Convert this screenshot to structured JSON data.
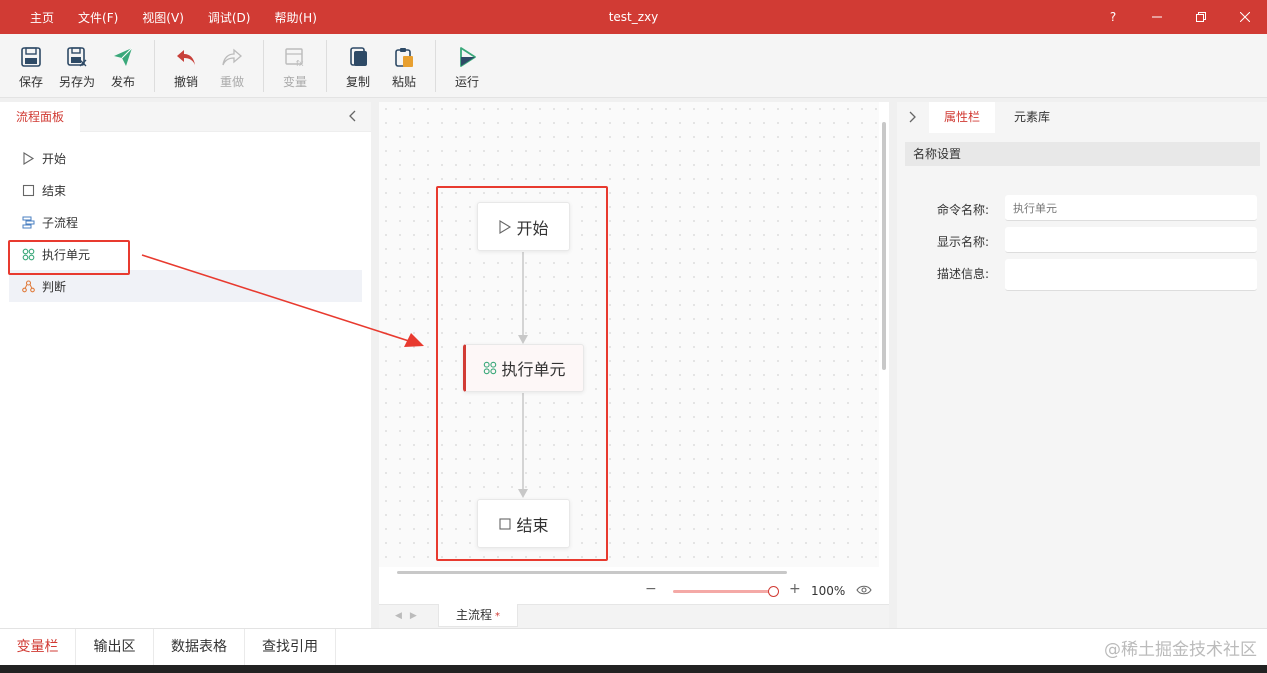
{
  "window": {
    "title": "test_zxy",
    "help": "?",
    "accent": "#d13b34"
  },
  "menu": [
    "主页",
    "文件(F)",
    "视图(V)",
    "调试(D)",
    "帮助(H)"
  ],
  "toolbar": {
    "save": "保存",
    "save_as": "另存为",
    "publish": "发布",
    "undo": "撤销",
    "redo": "重做",
    "variable": "变量",
    "copy": "复制",
    "paste": "粘贴",
    "run": "运行"
  },
  "left_panel": {
    "tab": "流程面板",
    "items": [
      {
        "label": "开始",
        "icon": "play-outline-icon"
      },
      {
        "label": "结束",
        "icon": "square-outline-icon"
      },
      {
        "label": "子流程",
        "icon": "subflow-icon"
      },
      {
        "label": "执行单元",
        "icon": "execution-unit-icon"
      },
      {
        "label": "判断",
        "icon": "decision-icon"
      }
    ]
  },
  "canvas": {
    "nodes": {
      "start": "开始",
      "exec": "执行单元",
      "end": "结束"
    },
    "zoom": "100%",
    "flow_tab": "主流程",
    "flow_tab_modified": "*"
  },
  "right_panel": {
    "tabs": [
      "属性栏",
      "元素库"
    ],
    "section": "名称设置",
    "fields": {
      "command_name_label": "命令名称:",
      "command_name_value": "执行单元",
      "display_name_label": "显示名称:",
      "display_name_value": "",
      "description_label": "描述信息:",
      "description_value": ""
    }
  },
  "bottom_tabs": [
    "变量栏",
    "输出区",
    "数据表格",
    "查找引用"
  ],
  "watermark": "@稀土掘金技术社区"
}
